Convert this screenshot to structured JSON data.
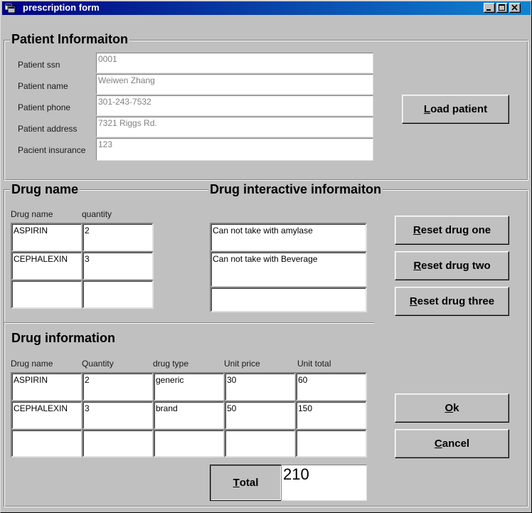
{
  "window": {
    "title": "prescription form",
    "controls": {
      "minimize": "minimize",
      "maximize": "maximize",
      "close": "close"
    }
  },
  "patient": {
    "legend": "Patient Informaiton",
    "fields": [
      {
        "label": "Patient ssn",
        "value": "0001"
      },
      {
        "label": "Patient name",
        "value": "Weiwen Zhang"
      },
      {
        "label": "Patient phone",
        "value": "301-243-7532"
      },
      {
        "label": "Patient address",
        "value": "7321 Riggs Rd."
      },
      {
        "label": "Pacient insurance",
        "value": "123"
      }
    ],
    "load_button": {
      "accel": "L",
      "rest": "oad patient"
    }
  },
  "drug_name": {
    "legend": "Drug name",
    "headers": [
      "Drug name",
      "quantity"
    ],
    "rows": [
      [
        "ASPIRIN",
        "2"
      ],
      [
        "CEPHALEXIN",
        "3"
      ],
      [
        "",
        ""
      ]
    ]
  },
  "interaction": {
    "legend": "Drug interactive informaiton",
    "rows": [
      "Can not take with amylase",
      "Can not take with Beverage",
      ""
    ]
  },
  "reset_buttons": [
    {
      "accel": "R",
      "rest": "eset drug one"
    },
    {
      "accel": "R",
      "rest": "eset drug two"
    },
    {
      "accel": "R",
      "rest": "eset drug three"
    }
  ],
  "drug_info": {
    "legend": "Drug information",
    "headers": [
      "Drug name",
      "Quantity",
      "drug type",
      "Unit price",
      "Unit total"
    ],
    "rows": [
      [
        "ASPIRIN",
        "2",
        "generic",
        "30",
        "60"
      ],
      [
        "CEPHALEXIN",
        "3",
        "brand",
        "50",
        "150"
      ],
      [
        "",
        "",
        "",
        "",
        ""
      ]
    ]
  },
  "ok_button": {
    "accel": "O",
    "rest": "k"
  },
  "cancel_button": {
    "accel": "C",
    "rest": "ancel"
  },
  "total": {
    "button": {
      "accel": "T",
      "rest": "otal"
    },
    "value": "210"
  },
  "colors": {
    "titlebar_start": "#000080",
    "titlebar_end": "#1084d0",
    "face": "#c0c0c0",
    "field_text_disabled": "#808080"
  }
}
